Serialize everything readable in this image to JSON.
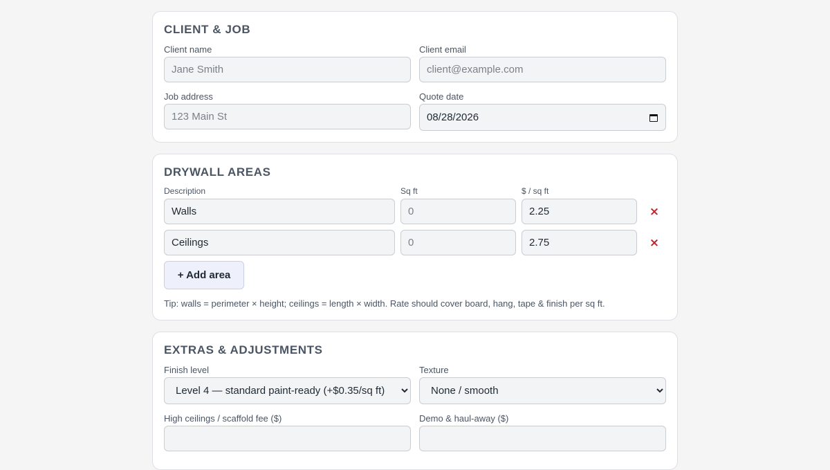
{
  "client_job": {
    "title": "CLIENT & JOB",
    "client_name": {
      "label": "Client name",
      "placeholder": "Jane Smith",
      "value": ""
    },
    "client_email": {
      "label": "Client email",
      "placeholder": "client@example.com",
      "value": ""
    },
    "job_address": {
      "label": "Job address",
      "placeholder": "123 Main St",
      "value": ""
    },
    "quote_date": {
      "label": "Quote date",
      "value": "08/28/2026"
    }
  },
  "drywall_areas": {
    "title": "DRYWALL AREAS",
    "columns": {
      "description": "Description",
      "sqft": "Sq ft",
      "rate": "$ / sq ft"
    },
    "rows": [
      {
        "description": "Walls",
        "sqft_placeholder": "0",
        "rate": "2.25"
      },
      {
        "description": "Ceilings",
        "sqft_placeholder": "0",
        "rate": "2.75"
      }
    ],
    "remove_label": "×",
    "add_label": "+ Add area",
    "tip": "Tip: walls = perimeter × height; ceilings = length × width. Rate should cover board, hang, tape & finish per sq ft."
  },
  "extras": {
    "title": "EXTRAS & ADJUSTMENTS",
    "finish_level": {
      "label": "Finish level",
      "selected": "Level 4 — standard paint-ready (+$0.35/sq ft)"
    },
    "texture": {
      "label": "Texture",
      "selected": "None / smooth"
    },
    "high_ceilings": {
      "label": "High ceilings / scaffold fee ($)"
    },
    "demo": {
      "label": "Demo & haul-away ($)"
    }
  }
}
